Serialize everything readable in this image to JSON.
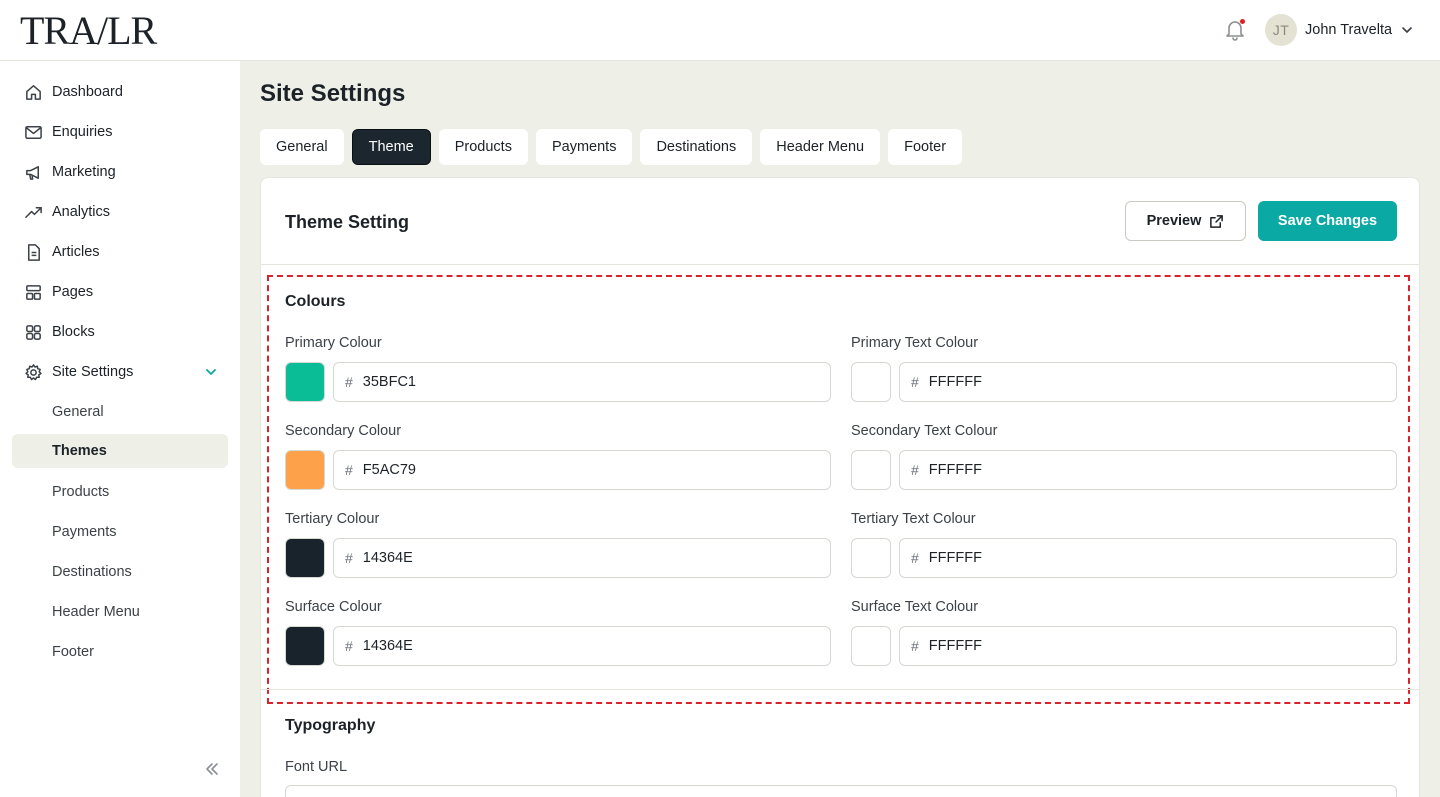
{
  "app": {
    "logo": "TRA/LR"
  },
  "user": {
    "initials": "JT",
    "name": "John Travelta"
  },
  "sidebar": {
    "items": [
      {
        "label": "Dashboard",
        "icon": "home-icon"
      },
      {
        "label": "Enquiries",
        "icon": "mail-icon"
      },
      {
        "label": "Marketing",
        "icon": "megaphone-icon"
      },
      {
        "label": "Analytics",
        "icon": "trending-up-icon"
      },
      {
        "label": "Articles",
        "icon": "document-icon"
      },
      {
        "label": "Pages",
        "icon": "pages-icon"
      },
      {
        "label": "Blocks",
        "icon": "blocks-icon"
      },
      {
        "label": "Site Settings",
        "icon": "gear-icon"
      }
    ],
    "sub_items": [
      "General",
      "Themes",
      "Products",
      "Payments",
      "Destinations",
      "Header Menu",
      "Footer"
    ],
    "active_sub": "Themes"
  },
  "main": {
    "title": "Site Settings",
    "tabs": [
      "General",
      "Theme",
      "Products",
      "Payments",
      "Destinations",
      "Header Menu",
      "Footer"
    ],
    "active_tab": "Theme"
  },
  "theme": {
    "title": "Theme Setting",
    "preview_label": "Preview",
    "save_label": "Save Changes",
    "colours_title": "Colours",
    "colours": [
      {
        "label": "Primary Colour",
        "value": "35BFC1",
        "swatch": "#0bbd96",
        "text_label": "Primary Text Colour",
        "text_value": "FFFFFF",
        "text_swatch": "#FFFFFF"
      },
      {
        "label": "Secondary Colour",
        "value": "F5AC79",
        "swatch": "#fda24b",
        "text_label": "Secondary Text Colour",
        "text_value": "FFFFFF",
        "text_swatch": "#FFFFFF"
      },
      {
        "label": "Tertiary Colour",
        "value": "14364E",
        "swatch": "#18232b",
        "text_label": "Tertiary Text Colour",
        "text_value": "FFFFFF",
        "text_swatch": "#FFFFFF"
      },
      {
        "label": "Surface Colour",
        "value": "14364E",
        "swatch": "#18232b",
        "text_label": "Surface Text Colour",
        "text_value": "FFFFFF",
        "text_swatch": "#FFFFFF"
      }
    ],
    "typography_title": "Typography",
    "font_url_label": "Font URL",
    "font_url_value": ""
  },
  "colors": {
    "accent": "#0aa9a4",
    "dark": "#1c262f",
    "highlight_border": "#d8232a",
    "background": "#eef0e8"
  }
}
